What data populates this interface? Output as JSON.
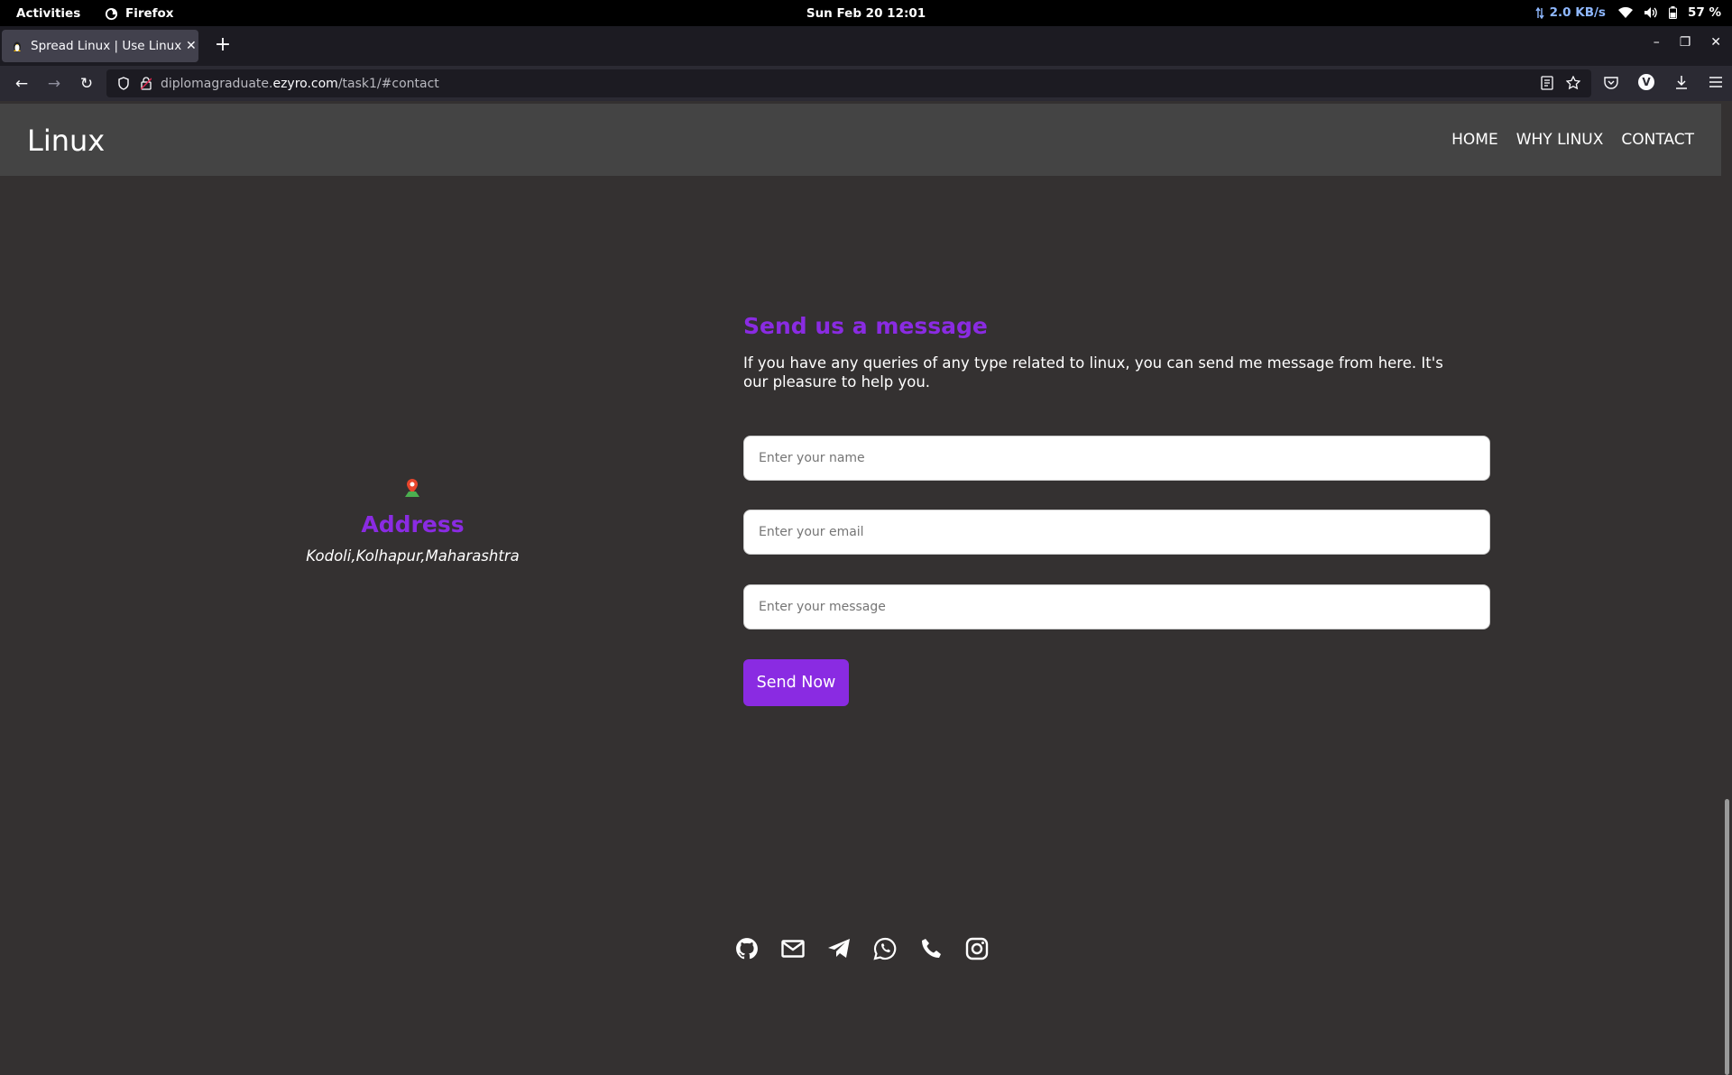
{
  "system": {
    "activities": "Activities",
    "app_name": "Firefox",
    "clock": "Sun Feb 20  12:01",
    "net_speed": "2.0 KB/s",
    "battery": "57 %"
  },
  "browser": {
    "tab_title": "Spread Linux | Use Linux |",
    "url_prefix": "diplomagraduate.",
    "url_domain": "ezyro.com",
    "url_path": "/task1/#contact",
    "profile_initial": "V"
  },
  "site": {
    "brand": "Linux",
    "nav": [
      {
        "label": "HOME"
      },
      {
        "label": "WHY LINUX"
      },
      {
        "label": "CONTACT"
      }
    ],
    "address": {
      "title": "Address",
      "text": "Kodoli,Kolhapur,Maharashtra"
    },
    "form": {
      "title": "Send us a message",
      "description": "If you have any queries of any type related to linux, you can send me message from here. It's our pleasure to help you.",
      "name_placeholder": "Enter your name",
      "email_placeholder": "Enter your email",
      "message_placeholder": "Enter your message",
      "name_value": "",
      "email_value": "",
      "message_value": "",
      "submit_label": "Send Now"
    },
    "social_icons": [
      "github-icon",
      "mail-icon",
      "telegram-icon",
      "whatsapp-icon",
      "phone-icon",
      "instagram-icon"
    ]
  },
  "colors": {
    "accent": "#8a2be2",
    "page_bg": "#343131",
    "header_bg": "#444444"
  }
}
